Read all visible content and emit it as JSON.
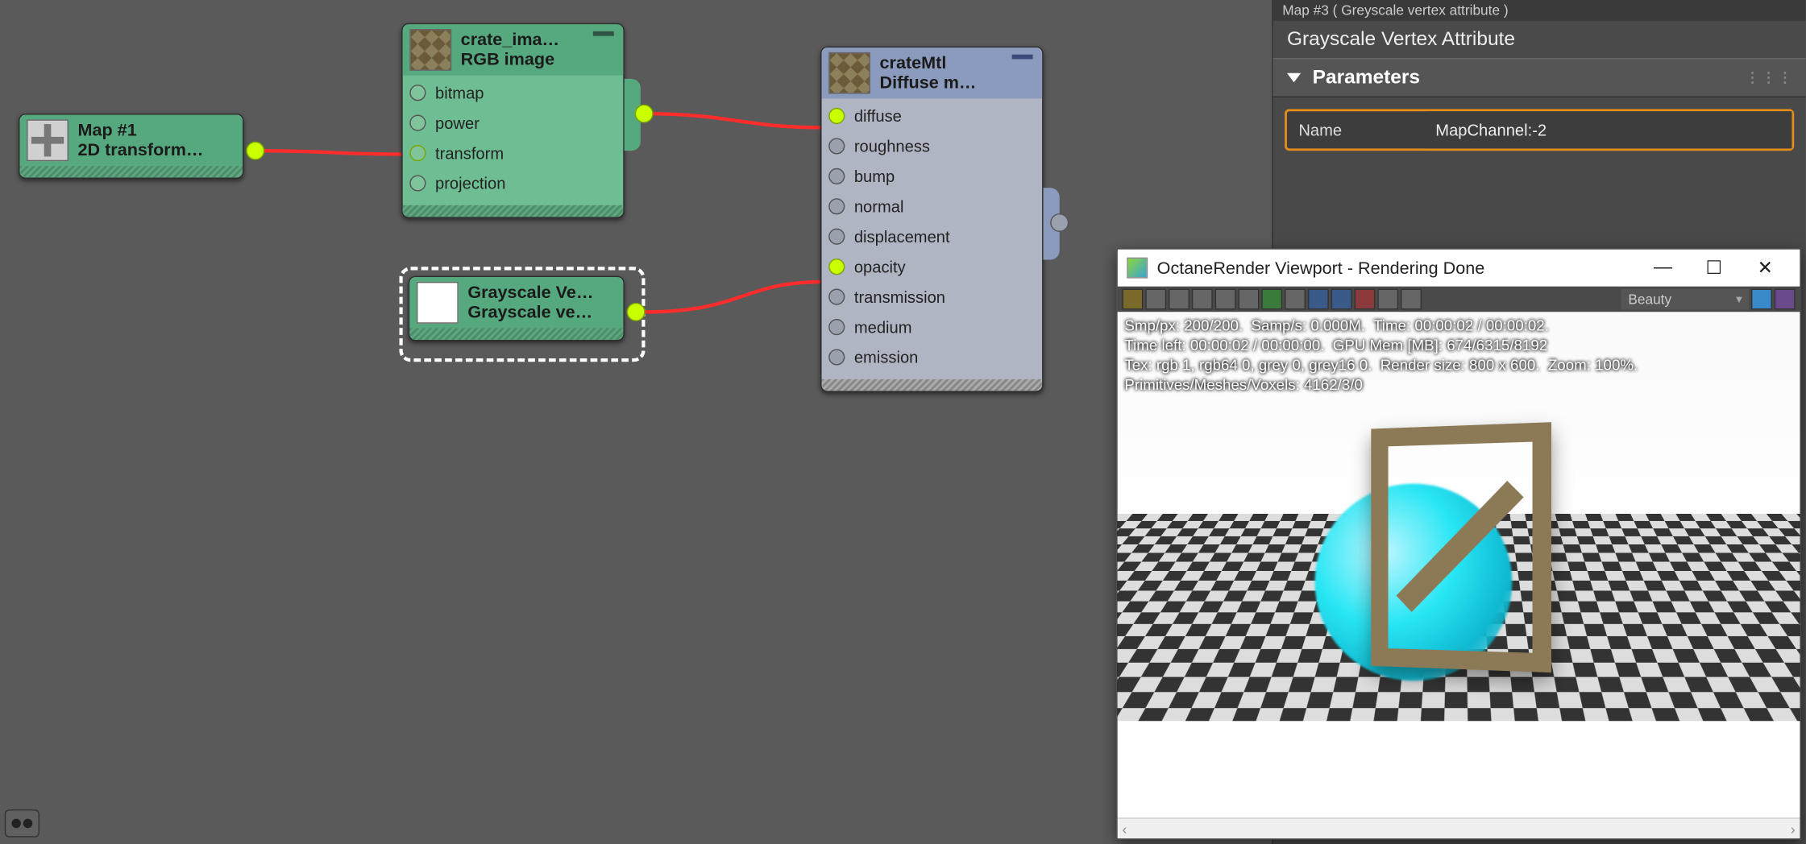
{
  "nodes": {
    "map1": {
      "title": "Map #1",
      "subtitle": "2D  transform…"
    },
    "crate_img": {
      "title": "crate_ima…",
      "subtitle": "RGB image",
      "slots": [
        "bitmap",
        "power",
        "transform",
        "projection"
      ]
    },
    "gva": {
      "title": "Grayscale  Ve…",
      "subtitle": "Grayscale  ve…"
    },
    "crate_mtl": {
      "title": "crateMtl",
      "subtitle": "Diffuse  m…",
      "slots": [
        "diffuse",
        "roughness",
        "bump",
        "normal",
        "displacement",
        "opacity",
        "transmission",
        "medium",
        "emission"
      ]
    }
  },
  "panel": {
    "crumb": "Map #3   ( Greyscale vertex attribute )",
    "title": "Grayscale Vertex Attribute",
    "section": "Parameters",
    "name_label": "Name",
    "name_value": "MapChannel:-2"
  },
  "viewport": {
    "title": "OctaneRender Viewport - Rendering Done",
    "combo": "Beauty",
    "stats": {
      "l1": "Smp/px: 200/200.  Samp/s: 0.000M.  Time: 00:00:02 / 00:00:02.",
      "l2": "Time left: 00:00:02 / 00:00:00.  GPU Mem [MB]: 674/6315/8192",
      "l3": "Tex: rgb 1, rgb64 0, grey 0, grey16 0.  Render size: 800 x 600.  Zoom: 100%.",
      "l4": "Primitives/Meshes/Voxels: 4162/3/0"
    }
  }
}
